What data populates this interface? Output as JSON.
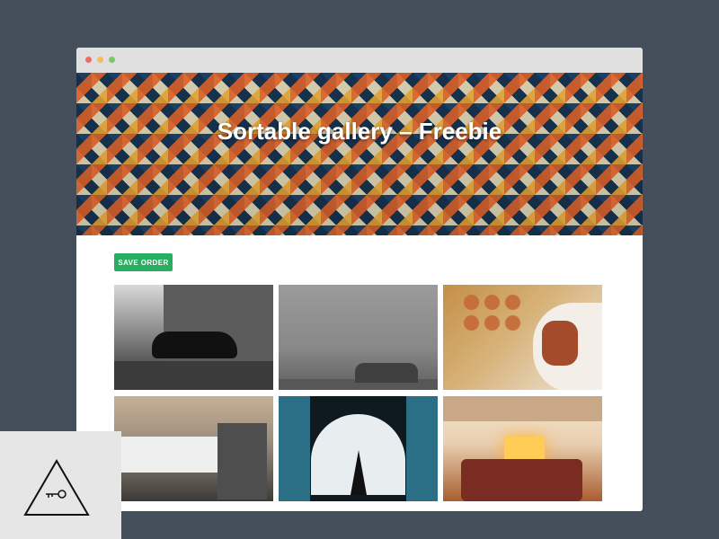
{
  "hero": {
    "title": "Sortable gallery – Freebie"
  },
  "toolbar": {
    "save_label": "SAVE ORDER"
  },
  "gallery": {
    "tiles": [
      {
        "name": "car-photo"
      },
      {
        "name": "foggy-landscape-photo"
      },
      {
        "name": "gingerbread-tin-photo"
      },
      {
        "name": "cafe-table-photo"
      },
      {
        "name": "tripod-window-photo"
      },
      {
        "name": "fireplace-room-photo"
      }
    ]
  },
  "colors": {
    "background": "#454f5c",
    "button": "#27ae60",
    "titlebar": "#e0e0e0"
  },
  "icons": {
    "logo": "triangle-key-icon"
  }
}
